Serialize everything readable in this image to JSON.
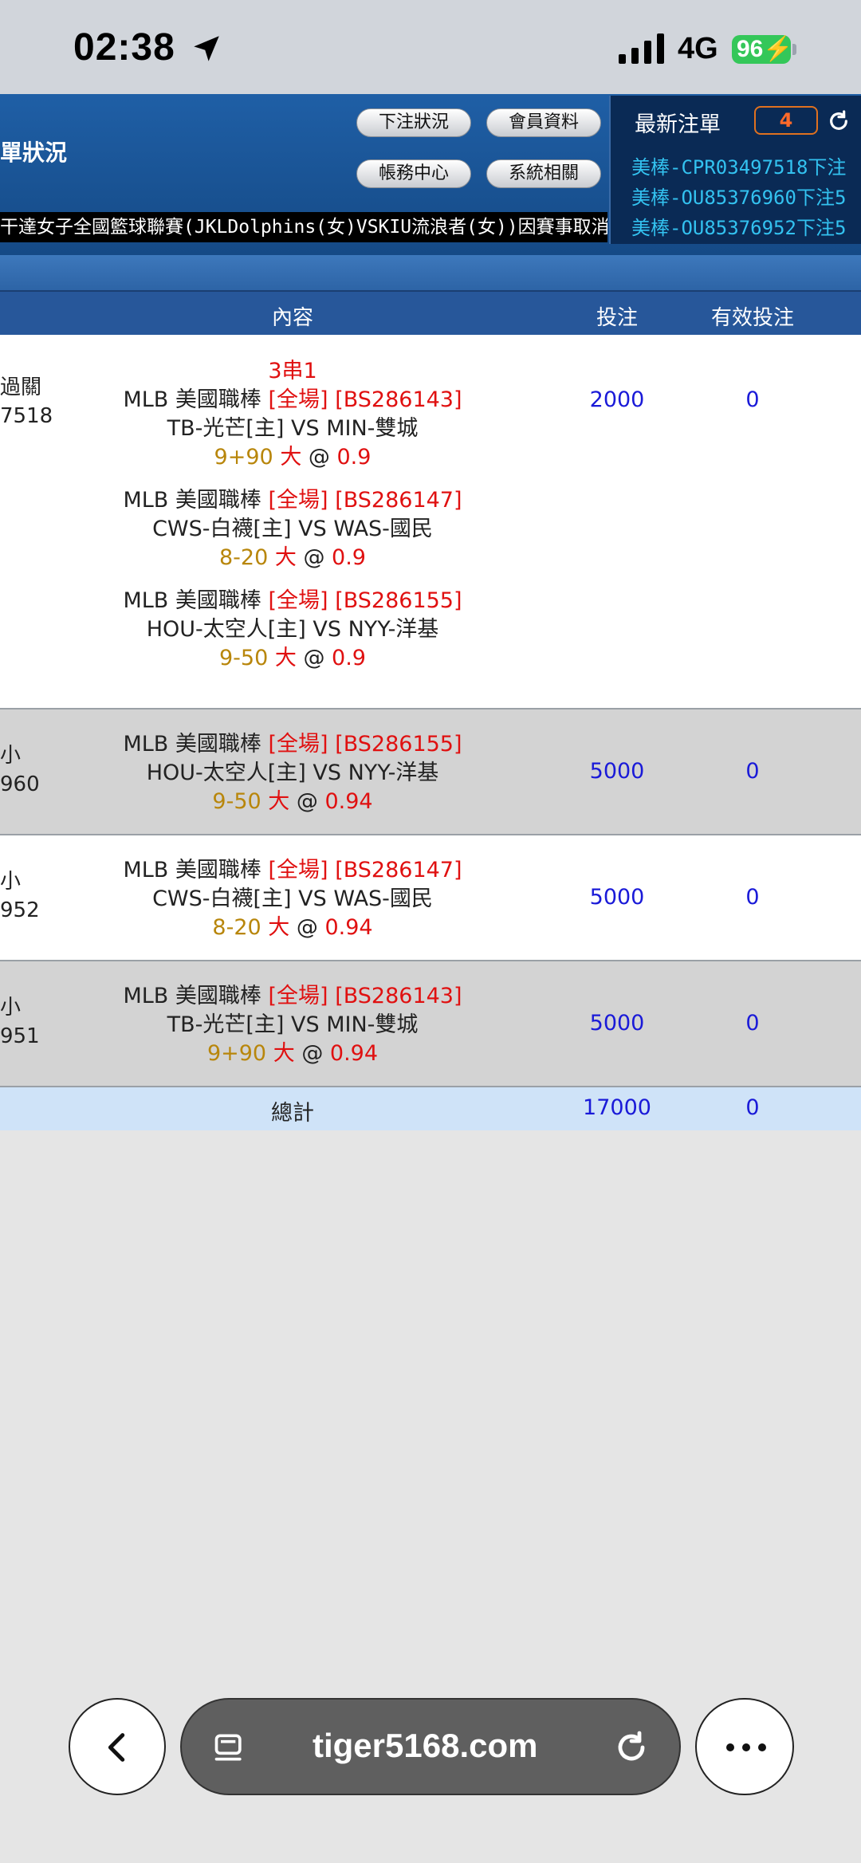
{
  "status_bar": {
    "time": "02:38",
    "network": "4G",
    "battery": "96"
  },
  "header": {
    "title": "單狀況",
    "buttons": {
      "bet_status": "下注狀況",
      "member_info": "會員資料",
      "accounts": "帳務中心",
      "system": "系統相關"
    },
    "ticker": "干達女子全國籃球聯賽(JKLDolphins(女)VSKIU流浪者(女))因賽事取消",
    "latest": {
      "title": "最新注單",
      "count": "4",
      "items": [
        "美棒-CPR03497518下注",
        "美棒-OU85376960下注5",
        "美棒-OU85376952下注5"
      ]
    }
  },
  "table": {
    "headers": {
      "content": "內容",
      "bet": "投注",
      "valid": "有效投注"
    },
    "rows": [
      {
        "left_line1": "過關",
        "left_line2": "7518",
        "parlay": "3串1",
        "legs": [
          {
            "league": "MLB 美國職棒",
            "period": "[全場]",
            "code": "[BS286143]",
            "teams": "TB-光芒[主] VS MIN-雙城",
            "line": "9+90",
            "side": "大",
            "at": "@",
            "odds": "0.9"
          },
          {
            "league": "MLB 美國職棒",
            "period": "[全場]",
            "code": "[BS286147]",
            "teams": "CWS-白襪[主] VS WAS-國民",
            "line": "8-20",
            "side": "大",
            "at": "@",
            "odds": "0.9"
          },
          {
            "league": "MLB 美國職棒",
            "period": "[全場]",
            "code": "[BS286155]",
            "teams": "HOU-太空人[主] VS NYY-洋基",
            "line": "9-50",
            "side": "大",
            "at": "@",
            "odds": "0.9"
          }
        ],
        "bet": "2000",
        "valid": "0"
      },
      {
        "left_line1": "小",
        "left_line2": "960",
        "legs": [
          {
            "league": "MLB 美國職棒",
            "period": "[全場]",
            "code": "[BS286155]",
            "teams": "HOU-太空人[主] VS NYY-洋基",
            "line": "9-50",
            "side": "大",
            "at": "@",
            "odds": "0.94"
          }
        ],
        "bet": "5000",
        "valid": "0"
      },
      {
        "left_line1": "小",
        "left_line2": "952",
        "legs": [
          {
            "league": "MLB 美國職棒",
            "period": "[全場]",
            "code": "[BS286147]",
            "teams": "CWS-白襪[主] VS WAS-國民",
            "line": "8-20",
            "side": "大",
            "at": "@",
            "odds": "0.94"
          }
        ],
        "bet": "5000",
        "valid": "0"
      },
      {
        "left_line1": "小",
        "left_line2": "951",
        "legs": [
          {
            "league": "MLB 美國職棒",
            "period": "[全場]",
            "code": "[BS286143]",
            "teams": "TB-光芒[主] VS MIN-雙城",
            "line": "9+90",
            "side": "大",
            "at": "@",
            "odds": "0.94"
          }
        ],
        "bet": "5000",
        "valid": "0"
      }
    ],
    "total": {
      "label": "總計",
      "bet": "17000",
      "valid": "0"
    }
  },
  "browser": {
    "url": "tiger5168.com"
  }
}
